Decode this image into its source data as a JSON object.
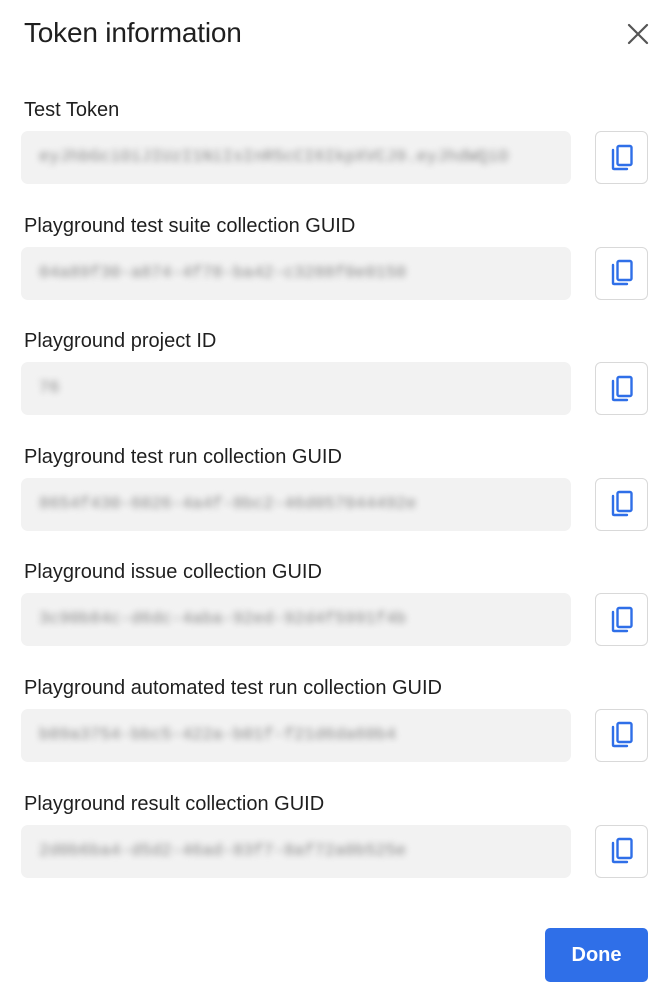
{
  "dialog": {
    "title": "Token information",
    "close_icon": "close-icon",
    "done_label": "Done"
  },
  "fields": [
    {
      "label": "Test Token",
      "value": "eyJhbGciOiJIUzI1NiIsInR5cCI6IkpXVCJ9.eyJhdWQiO",
      "copy_icon": "copy-icon"
    },
    {
      "label": "Playground test suite collection GUID",
      "value": "04a89f30-a874-4f78-ba42-c3288f0e0150",
      "copy_icon": "copy-icon"
    },
    {
      "label": "Playground project ID",
      "value": "76",
      "copy_icon": "copy-icon"
    },
    {
      "label": "Playground test run collection GUID",
      "value": "8654f430-6026-4a4f-8bc2-46d057044492e",
      "copy_icon": "copy-icon"
    },
    {
      "label": "Playground issue collection GUID",
      "value": "3c90b84c-d6dc-4aba-92ed-92d4f5991f4b",
      "copy_icon": "copy-icon"
    },
    {
      "label": "Playground automated test run collection GUID",
      "value": "b09a3754-bbc5-422a-b01f-f21d6da60b4",
      "copy_icon": "copy-icon"
    },
    {
      "label": "Playground result collection GUID",
      "value": "2d0b6ba4-d5d2-46ad-83f7-8af72a0b525e",
      "copy_icon": "copy-icon"
    }
  ],
  "colors": {
    "accent": "#2f6fe8",
    "field_bg": "#f2f2f2",
    "text": "#1f1f1f"
  }
}
